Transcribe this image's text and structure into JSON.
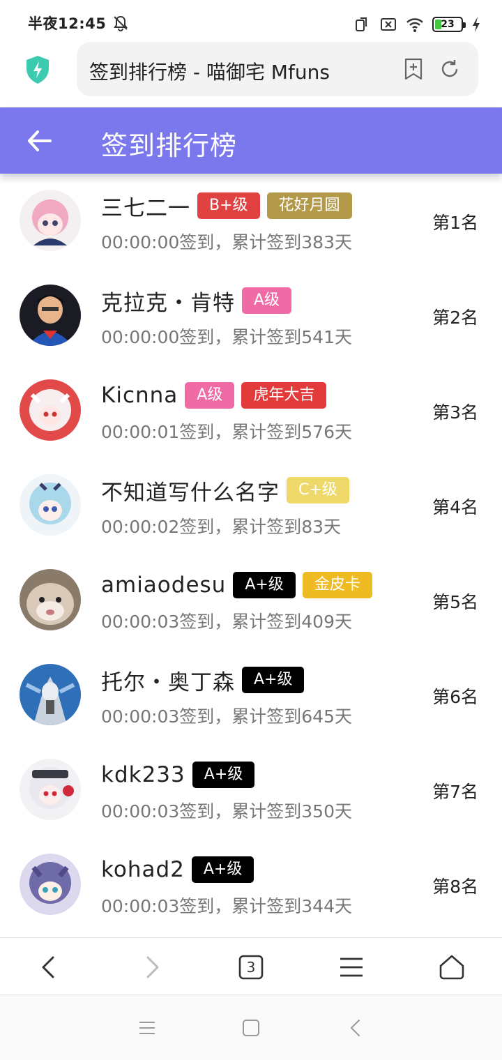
{
  "status_bar": {
    "time": "半夜12:45",
    "battery": "23"
  },
  "browser": {
    "url_title": "签到排行榜 - 喵御宅 Mfuns",
    "tab_count": "3"
  },
  "header": {
    "title": "签到排行榜"
  },
  "users": [
    {
      "name": "三七二一",
      "sub": "00:00:00签到，累计签到383天",
      "rank": "第1名",
      "badges": [
        {
          "text": "B+级",
          "color": "#e04242"
        },
        {
          "text": "花好月圆",
          "color": "#b39a4a"
        }
      ]
    },
    {
      "name": "克拉克・肯特",
      "sub": "00:00:00签到，累计签到541天",
      "rank": "第2名",
      "badges": [
        {
          "text": "A级",
          "color": "#f06aa6"
        }
      ]
    },
    {
      "name": "Kicnna",
      "sub": "00:00:01签到，累计签到576天",
      "rank": "第3名",
      "badges": [
        {
          "text": "A级",
          "color": "#f06aa6"
        },
        {
          "text": "虎年大吉",
          "color": "#e23b3b"
        }
      ]
    },
    {
      "name": "不知道写什么名字",
      "sub": "00:00:02签到，累计签到83天",
      "rank": "第4名",
      "badges": [
        {
          "text": "C+级",
          "color": "#efd86a"
        }
      ]
    },
    {
      "name": "amiaodesu",
      "sub": "00:00:03签到，累计签到409天",
      "rank": "第5名",
      "badges": [
        {
          "text": "A+级",
          "color": "#000000"
        },
        {
          "text": "金皮卡",
          "color": "#eebb22"
        }
      ]
    },
    {
      "name": "托尔・奥丁森",
      "sub": "00:00:03签到，累计签到645天",
      "rank": "第6名",
      "badges": [
        {
          "text": "A+级",
          "color": "#000000"
        }
      ]
    },
    {
      "name": "kdk233",
      "sub": "00:00:03签到，累计签到350天",
      "rank": "第7名",
      "badges": [
        {
          "text": "A+级",
          "color": "#000000"
        }
      ]
    },
    {
      "name": "kohad2",
      "sub": "00:00:03签到，累计签到344天",
      "rank": "第8名",
      "badges": [
        {
          "text": "A+级",
          "color": "#000000"
        }
      ]
    }
  ],
  "colors": {
    "header_bg": "#7b78ee",
    "accent_shield": "#3ccab0"
  },
  "icons": {
    "back": "arrow-left-icon",
    "bookmark_add": "bookmark-add-icon",
    "refresh": "refresh-icon",
    "nav_back": "chevron-left-icon",
    "nav_forward": "chevron-right-icon",
    "tabs": "tabs-icon",
    "menu": "menu-icon",
    "home": "home-icon"
  }
}
